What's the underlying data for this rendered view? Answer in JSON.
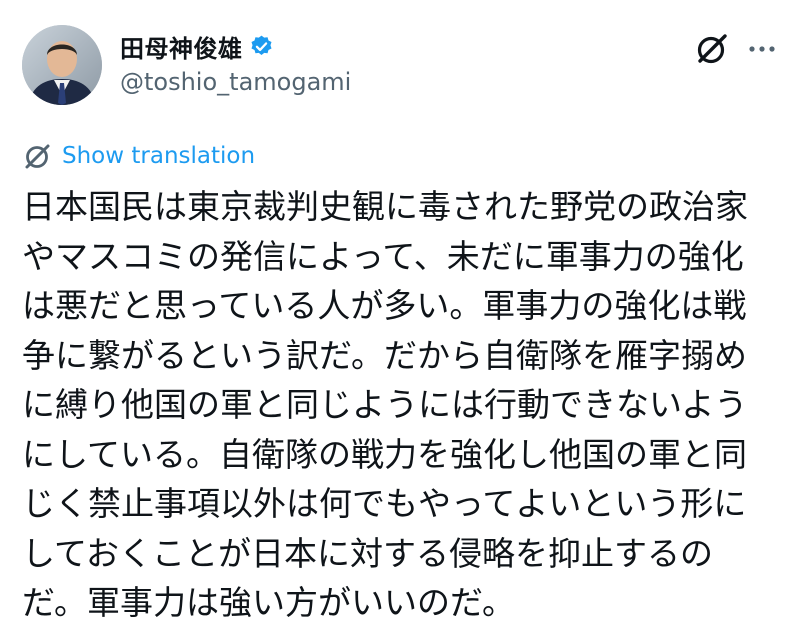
{
  "author": {
    "display_name": "田母神俊雄",
    "handle": "@toshio_tamogami",
    "verified": true
  },
  "icons": {
    "verified": "verified-badge-icon",
    "grok": "grok-icon",
    "more": "more-options-icon",
    "translate": "translate-icon"
  },
  "colors": {
    "accent": "#1d9bf0",
    "text": "#0f1419",
    "secondary_text": "#536471"
  },
  "translation": {
    "label": "Show translation"
  },
  "tweet": {
    "lines": [
      "日本国民は東京裁判史観に毒された野党の政治家",
      "やマスコミの発信によって、未だに軍事力の強化",
      "は悪だと思っている人が多い。軍事力の強化は戦",
      "争に繋がるという訳だ。だから自衛隊を雁字搦め",
      "に縛り他国の軍と同じようには行動できないよう",
      "にしている。自衛隊の戦力を強化し他国の軍と同",
      "じく禁止事項以外は何でもやってよいという形に",
      "しておくことが日本に対する侵略を抑止するの",
      "だ。軍事力は強い方がいいのだ。"
    ]
  }
}
